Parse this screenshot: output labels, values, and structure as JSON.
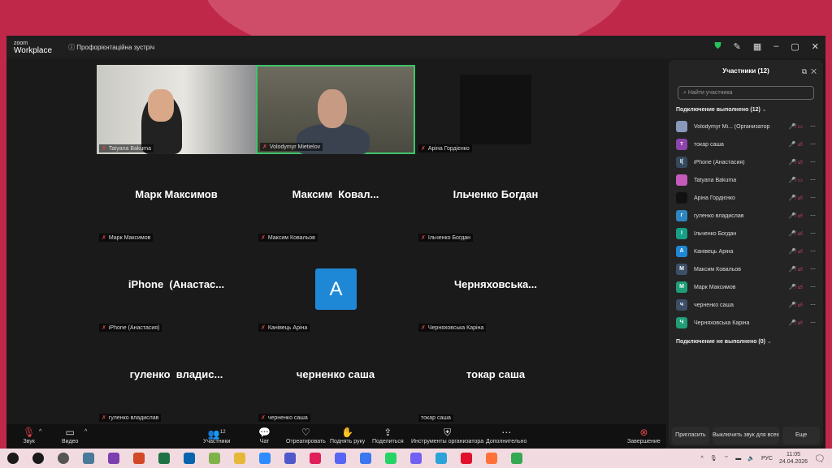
{
  "window": {
    "brand_small": "zoom",
    "brand": "Workplace",
    "meeting_title": "Профорієнтаційна зустріч"
  },
  "tiles": [
    {
      "label": "Tatyana Bakuma",
      "big": ""
    },
    {
      "label": "Volodymyr Mietielov",
      "big": ""
    },
    {
      "label": "Аріна Гордієнко",
      "big": ""
    },
    {
      "label": "Марк Максимов",
      "big": "Марк Максимов"
    },
    {
      "label": "Максим Ковальов",
      "big": "Максим  Ковал..."
    },
    {
      "label": "Ільченко Богдан",
      "big": "Ільченко Богдан"
    },
    {
      "label": "iPhone (Анастасия)",
      "big": "iPhone  (Анастас..."
    },
    {
      "label": "Канівець Аріна",
      "big": "",
      "avatar": "A"
    },
    {
      "label": "Черняховська Каріна",
      "big": "Черняховська..."
    },
    {
      "label": "гуленко владислав",
      "big": "гуленко  владис..."
    },
    {
      "label": "черненко саша",
      "big": "черненко саша"
    },
    {
      "label": "токар саша",
      "big": "токар саша"
    }
  ],
  "toolbar": {
    "audio": "Звук",
    "video": "Видео",
    "participants": "Участники",
    "participants_count": "12",
    "chat": "Чат",
    "react": "Отреагировать",
    "raise_hand": "Поднять руку",
    "share": "Поделиться",
    "host_tools": "Инструменты организатора",
    "more": "Дополнительно",
    "end": "Завершение"
  },
  "panel": {
    "title": "Участники (12)",
    "search_placeholder": "Найти участника",
    "connected": "Подключение выполнено (12)",
    "not_connected": "Подключение не выполнено (0)",
    "participants": [
      {
        "name": "Volodymyr Mi...  (Организатор, я)",
        "initial": "",
        "color": "#8899bb",
        "icons": "🎤̸ ▭"
      },
      {
        "name": "токар саша",
        "initial": "т",
        "color": "#8e44ad",
        "icons": "🎤 ▭̸"
      },
      {
        "name": "iPhone (Анастасия)",
        "initial": "I(",
        "color": "#34495e",
        "icons": "🎤̸ ▭̸"
      },
      {
        "name": "Tatyana Bakuma",
        "initial": "",
        "color": "#c45bb8",
        "icons": "🎤̸ ▭"
      },
      {
        "name": "Аріна Гордієнко",
        "initial": "",
        "color": "#111111",
        "icons": "🎤̸ ▭̸"
      },
      {
        "name": "гуленко владислав",
        "initial": "г",
        "color": "#2e86c1",
        "icons": "🎤̸ ▭̸"
      },
      {
        "name": "Ільченко Богдан",
        "initial": "І",
        "color": "#16a085",
        "icons": "🎤̸ ▭̸"
      },
      {
        "name": "Канівець Аріна",
        "initial": "А",
        "color": "#1f88d6",
        "icons": "🎤̸ ▭̸"
      },
      {
        "name": "Максим Ковальов",
        "initial": "М",
        "color": "#3d4f66",
        "icons": "🎤̸ ▭̸"
      },
      {
        "name": "Марк Максимов",
        "initial": "М",
        "color": "#1f9e77",
        "icons": "🎤̸ ▭̸"
      },
      {
        "name": "черненко саша",
        "initial": "ч",
        "color": "#3d4f66",
        "icons": "🎤̸ ▭̸"
      },
      {
        "name": "Черняховська Каріна",
        "initial": "Ч",
        "color": "#1f9e77",
        "icons": "🎤̸ ▭̸"
      }
    ],
    "invite": "Пригласить",
    "mute_all": "Выключить звук для всех",
    "more": "Еще"
  },
  "taskbar": {
    "lang": "РУС",
    "time": "11:05",
    "date": "24.04.2026"
  }
}
